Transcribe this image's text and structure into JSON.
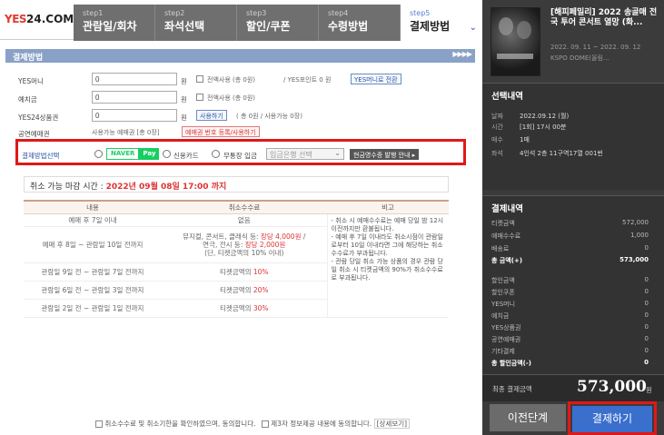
{
  "logo": {
    "part1": "YES",
    "part2": "24.COM"
  },
  "steps": [
    {
      "num": "step1",
      "label": "관람일/회차"
    },
    {
      "num": "step2",
      "label": "좌석선택"
    },
    {
      "num": "step3",
      "label": "할인/쿠폰"
    },
    {
      "num": "step4",
      "label": "수령방법"
    },
    {
      "num": "step5",
      "label": "결제방법"
    }
  ],
  "section_title": "결제방법",
  "section_arrows": "▶▶▶▶",
  "payment_rows": [
    {
      "label": "YES머니",
      "value": "0",
      "unit": "원",
      "use_all": "전액사용 (총 0원)",
      "extra": "/ YES포인트 0 원",
      "button": "YES머니로 전환"
    },
    {
      "label": "예치금",
      "value": "0",
      "unit": "원",
      "use_all": "전액사용 (총 0원)"
    },
    {
      "label": "YES24상품권",
      "value": "0",
      "unit": "원",
      "button": "사용하기",
      "extra": "( 총 0원 / 사용가능 0장)"
    },
    {
      "label": "공연예매권",
      "extra": "사용가능 예매권 [총 0장]",
      "button": "예매권 번호 등록/사용하기"
    }
  ],
  "method": {
    "label": "결제방법선택",
    "naver1": "NAVER",
    "naver2": "Pay",
    "card": "신용카드",
    "bank": "무통장 입금",
    "bank_select": "입금은행 선택",
    "receipt_button": "현금영수증 발행 안내 ▸"
  },
  "cancel": {
    "label": "취소 가능 마감 시간 : ",
    "deadline": "2022년 09월 08일 17:00 까지"
  },
  "fee_table": {
    "headers": [
      "내용",
      "취소수수료",
      "비고"
    ],
    "rows": [
      {
        "content": "예매 후 7일 이내",
        "fee": "없음"
      },
      {
        "content": "예매 후 8일 ~ 관람일 10일 전까지",
        "fee_a": "뮤지컬, 콘서트, 클래식 등: ",
        "fee_a_red": "장당 4,000원",
        "fee_a_tail": " /",
        "fee_b": "연극, 전시 등: ",
        "fee_b_red": "장당 2,000원",
        "fee_c": "(단, 티켓금액의 10% 이내)"
      },
      {
        "content": "관람일 9일 전 ~ 관람일 7일 전까지",
        "fee_a": "티켓금액의 ",
        "fee_red": "10%"
      },
      {
        "content": "관람일 6일 전 ~ 관람일 3일 전까지",
        "fee_a": "티켓금액의 ",
        "fee_red": "20%"
      },
      {
        "content": "관람일 2일 전 ~ 관람일 1일 전까지",
        "fee_a": "티켓금액의 ",
        "fee_red": "30%"
      }
    ],
    "note": "- 취소 시 예매수수료는 예매 당일 밤 12시 이전까지만 환불됩니다.\n- 예매 후 7일 이내라도 취소시점이 관람일로부터 10일 이내라면 그에 해당하는 취소수수료가 부과됩니다.\n- 관람 당일 취소 가능 상품의 경우 관람 당일 취소 시 티켓금액의 90%가 취소수수료로 부과됩니다."
  },
  "agree": {
    "text1": "취소수수료 및 취소기한을 확인하였으며, 동의합니다.",
    "text2": "제3자 정보제공 내용에 동의합니다.",
    "link": "[상세보기]"
  },
  "event": {
    "title": "[해피페밀리] 2022 송골매 전국 투어 콘서트 열망 (화...",
    "dates": "2022. 09. 11 ~ 2022. 09. 12",
    "venue": "KSPO DOME(올림..."
  },
  "selection": {
    "title": "선택내역",
    "items": [
      {
        "k": "날짜",
        "v": "2022.09.12 (월)"
      },
      {
        "k": "시간",
        "v": "[1회] 17시 00분"
      },
      {
        "k": "매수",
        "v": "1매"
      },
      {
        "k": "좌석",
        "v": "4인석 2층 11구역17열 001번"
      }
    ]
  },
  "payment_summary": {
    "title": "결제내역",
    "rows": [
      {
        "k": "티켓금액",
        "v": "572,000"
      },
      {
        "k": "예매수수료",
        "v": "1,000"
      },
      {
        "k": "배송료",
        "v": "0"
      },
      {
        "k": "총 금액(+)",
        "v": "573,000",
        "bold": true
      }
    ],
    "discount_rows": [
      {
        "k": "할인금액",
        "v": "0"
      },
      {
        "k": "할인쿠폰",
        "v": "0"
      },
      {
        "k": "YES머니",
        "v": "0"
      },
      {
        "k": "예치금",
        "v": "0"
      },
      {
        "k": "YES상품권",
        "v": "0"
      },
      {
        "k": "공연예매권",
        "v": "0"
      },
      {
        "k": "기타결제",
        "v": "0"
      },
      {
        "k": "총 할인금액(-)",
        "v": "0",
        "bold": true
      }
    ]
  },
  "total": {
    "label": "최종 결제금액",
    "value": "573,000",
    "unit": "원"
  },
  "buttons": {
    "prev": "이전단계",
    "pay": "결제하기"
  }
}
